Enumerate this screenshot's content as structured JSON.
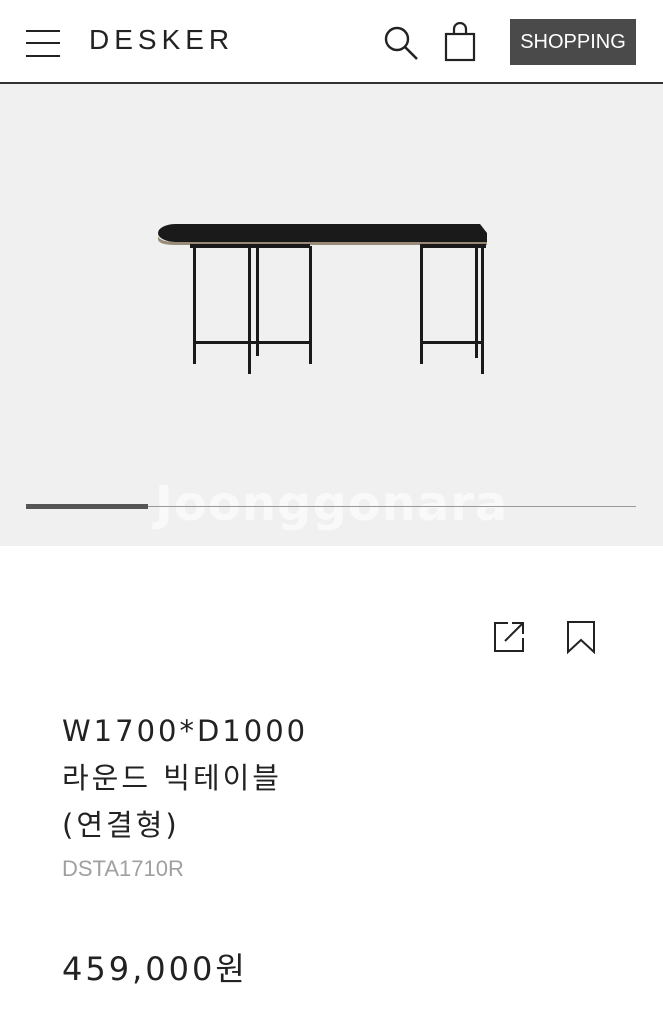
{
  "header": {
    "brand": "DESKER",
    "shopping_label": "SHOPPING"
  },
  "gallery": {
    "watermark": "Joonggonara",
    "slide_progress": 0.2
  },
  "product": {
    "name_lines": [
      "W1700*D1000",
      "라운드 빅테이블",
      "(연결형)"
    ],
    "sku": "DSTA1710R",
    "price": "459,000원"
  },
  "colors": {
    "header_border": "#333333",
    "shopping_button": "#4a4a4a",
    "gallery_bg": "#f0f0f0",
    "sku_text": "#a0a0a0"
  }
}
